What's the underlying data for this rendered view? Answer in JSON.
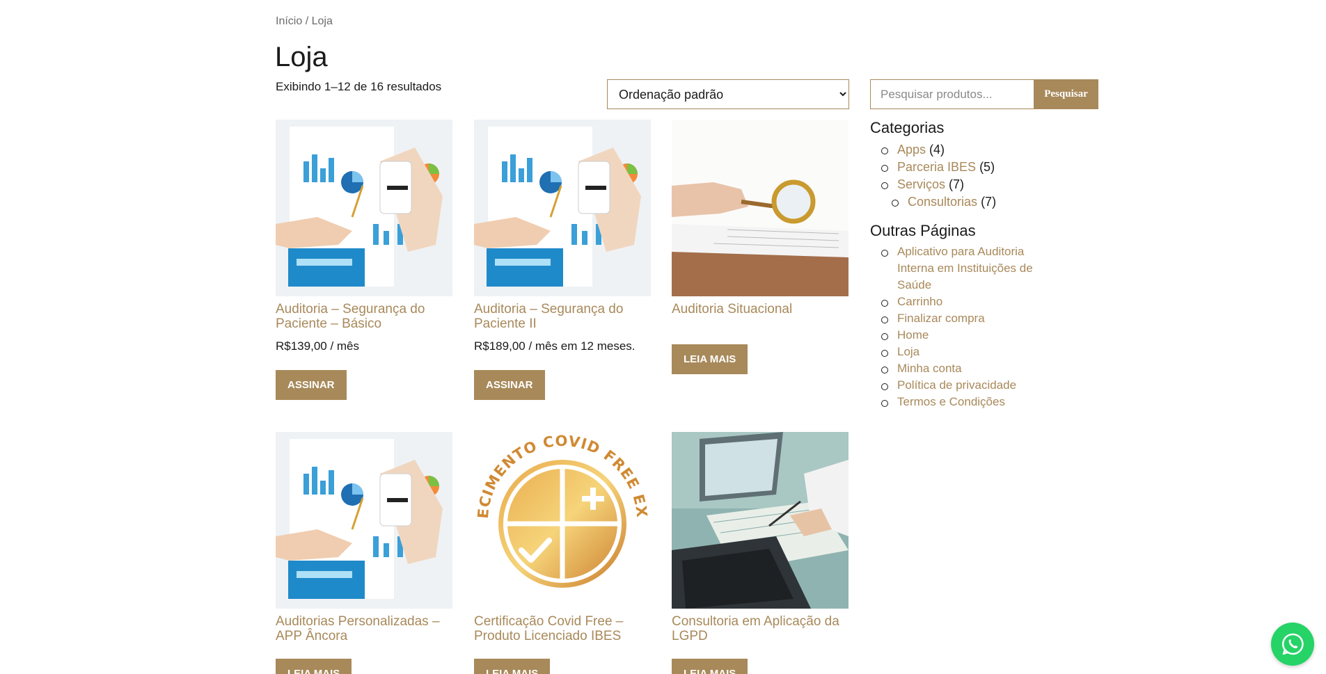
{
  "breadcrumb": {
    "home": "Início",
    "separator": " / ",
    "current": "Loja"
  },
  "page_title": "Loja",
  "result_count": "Exibindo 1–12 de 16 resultados",
  "ordering": {
    "selected": "Ordenação padrão"
  },
  "search": {
    "placeholder": "Pesquisar produtos...",
    "button": "Pesquisar"
  },
  "products": [
    {
      "title": "Auditoria – Segurança do Paciente – Básico",
      "price": "R$139,00 / mês",
      "button": "Assinar"
    },
    {
      "title": "Auditoria – Segurança do Paciente II",
      "price": "R$189,00 / mês em 12 meses.",
      "button": "Assinar"
    },
    {
      "title": "Auditoria Situacional",
      "price": "",
      "button": "Leia mais"
    },
    {
      "title": "Auditorias Personalizadas – APP Âncora",
      "price": "",
      "button": "Leia mais"
    },
    {
      "title": "Certificação Covid Free – Produto Licenciado IBES",
      "price": "",
      "button": "Leia mais"
    },
    {
      "title": "Consultoria em Aplicação da LGPD",
      "price": "",
      "button": "Leia mais"
    }
  ],
  "badge_text": "ESTABELECIMENTO COVID FREE EXCELENTE",
  "sidebar": {
    "categories_title": "Categorias",
    "categories": [
      {
        "label": "Apps",
        "count": "(4)"
      },
      {
        "label": "Parceria IBES",
        "count": "(5)"
      },
      {
        "label": "Serviços",
        "count": "(7)"
      },
      {
        "label": "Consultorias",
        "count": "(7)"
      }
    ],
    "pages_title": "Outras Páginas",
    "pages": [
      "Aplicativo para Auditoria Interna em Instituições de Saúde",
      "Carrinho",
      "Finalizar compra",
      "Home",
      "Loja",
      "Minha conta",
      "Política de privacidade",
      "Termos e Condições"
    ]
  },
  "colors": {
    "accent": "#a8895a",
    "text": "#1a1a1a",
    "whatsapp": "#25d366"
  },
  "icons": {
    "whatsapp": "whatsapp-icon"
  }
}
